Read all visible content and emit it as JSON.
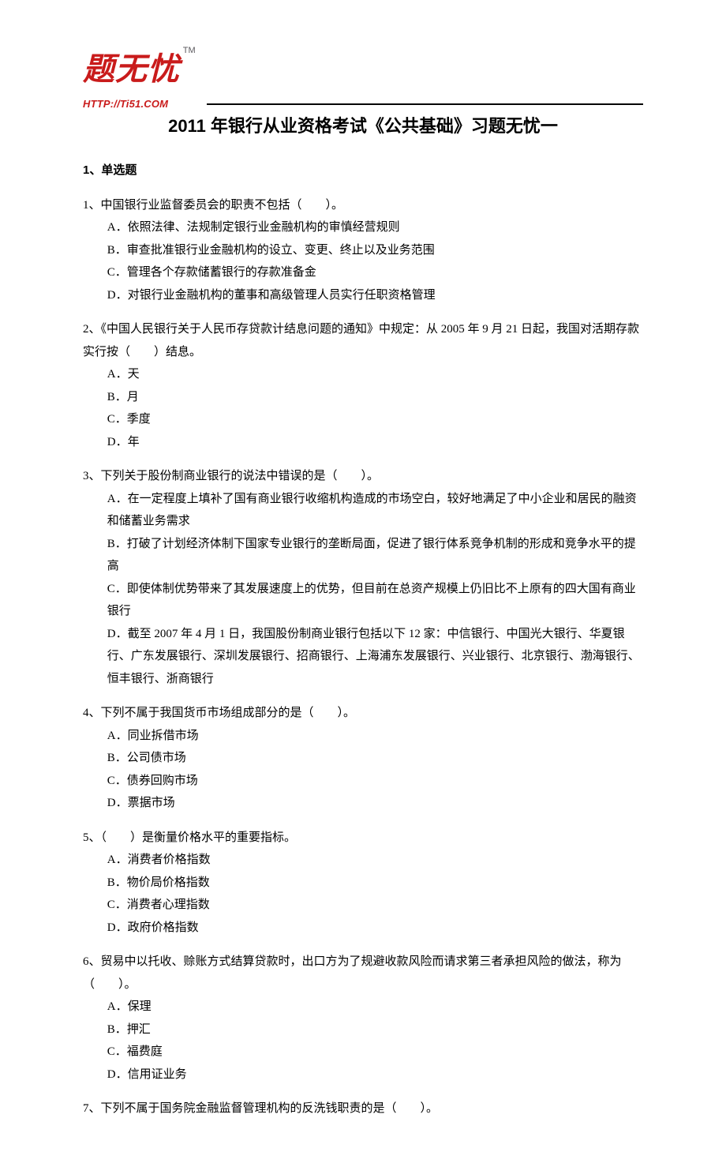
{
  "logo": {
    "cn": "题无忧",
    "tm": "TM",
    "url": "HTTP://Ti51.COM"
  },
  "title": "2011 年银行从业资格考试《公共基础》习题无忧一",
  "section_head": "1、单选题",
  "questions": [
    {
      "stem": "1、中国银行业监督委员会的职责不包括（　　）。",
      "options": [
        "A．依照法律、法规制定银行业金融机构的审慎经营规则",
        "B．审查批准银行业金融机构的设立、变更、终止以及业务范围",
        "C．管理各个存款储蓄银行的存款准备金",
        "D．对银行业金融机构的董事和高级管理人员实行任职资格管理"
      ]
    },
    {
      "stem": "2、《中国人民银行关于人民币存贷款计结息问题的通知》中规定：从 2005 年 9 月 21 日起，我国对活期存款实行按（　　）结息。",
      "options": [
        "A．天",
        "B．月",
        "C．季度",
        "D．年"
      ]
    },
    {
      "stem": "3、下列关于股份制商业银行的说法中错误的是（　　）。",
      "options": [
        "A．在一定程度上填补了国有商业银行收缩机构造成的市场空白，较好地满足了中小企业和居民的融资和储蓄业务需求",
        "B．打破了计划经济体制下国家专业银行的垄断局面，促进了银行体系竞争机制的形成和竞争水平的提高",
        "C．即使体制优势带来了其发展速度上的优势，但目前在总资产规模上仍旧比不上原有的四大国有商业银行",
        "D．截至 2007 年 4 月 1 日，我国股份制商业银行包括以下 12 家：中信银行、中国光大银行、华夏银行、广东发展银行、深圳发展银行、招商银行、上海浦东发展银行、兴业银行、北京银行、渤海银行、恒丰银行、浙商银行"
      ]
    },
    {
      "stem": "4、下列不属于我国货币市场组成部分的是（　　）。",
      "options": [
        "A．同业拆借市场",
        "B．公司债市场",
        "C．债券回购市场",
        "D．票据市场"
      ]
    },
    {
      "stem": "5、（　　）是衡量价格水平的重要指标。",
      "options": [
        "A．消费者价格指数",
        "B．物价局价格指数",
        "C．消费者心理指数",
        "D．政府价格指数"
      ]
    },
    {
      "stem": "6、贸易中以托收、赊账方式结算贷款时，出口方为了规避收款风险而请求第三者承担风险的做法，称为（　　）。",
      "options": [
        "A．保理",
        "B．押汇",
        "C．福费庭",
        "D．信用证业务"
      ]
    },
    {
      "stem": "7、下列不属于国务院金融监督管理机构的反洗钱职责的是（　　）。",
      "options": []
    }
  ]
}
